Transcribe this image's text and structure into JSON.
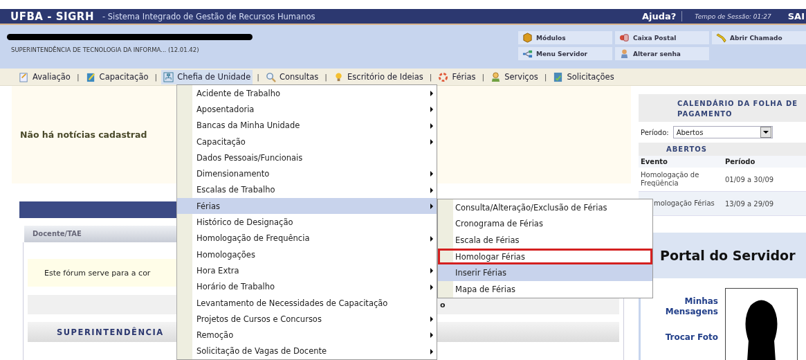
{
  "header": {
    "system": "UFBA - SIGRH",
    "subtitle": "- Sistema Integrado de Gestão de Recursos Humanos",
    "help": "Ajuda?",
    "session": "Tempo de Sessão: 01:27",
    "logout": "SAI"
  },
  "user": {
    "unit": "SUPERINTENDÊNCIA DE TECNOLOGIA DA INFORMA... (12.01.42)"
  },
  "shortcuts": [
    {
      "label": "Módulos",
      "kind": "box"
    },
    {
      "label": "Caixa Postal",
      "kind": "mail"
    },
    {
      "label": "Abrir Chamado",
      "kind": "hand"
    },
    {
      "label": "Menu Servidor",
      "kind": "network"
    },
    {
      "label": "Alterar senha",
      "kind": "user"
    }
  ],
  "menu_bar": {
    "separator": "|",
    "items": [
      {
        "label": "Avaliação",
        "kind": "clipboard",
        "selected": false
      },
      {
        "label": "Capacitação",
        "kind": "pencil",
        "selected": false
      },
      {
        "label": "Chefia de Unidade",
        "kind": "chart",
        "selected": true
      },
      {
        "label": "Consultas",
        "kind": "search",
        "selected": false
      },
      {
        "label": "Escritório de Ideias",
        "kind": "bulb",
        "selected": false
      },
      {
        "label": "Férias",
        "kind": "ring",
        "selected": false
      },
      {
        "label": "Serviços",
        "kind": "person",
        "selected": false
      },
      {
        "label": "Solicitações",
        "kind": "form",
        "selected": false
      }
    ]
  },
  "dropdown": [
    {
      "label": "Acidente de Trabalho",
      "submenu": true,
      "selected": false
    },
    {
      "label": "Aposentadoria",
      "submenu": true,
      "selected": false
    },
    {
      "label": "Bancas da Minha Unidade",
      "submenu": true,
      "selected": false
    },
    {
      "label": "Capacitação",
      "submenu": true,
      "selected": false
    },
    {
      "label": "Dados Pessoais/Funcionais",
      "submenu": false,
      "selected": false
    },
    {
      "label": "Dimensionamento",
      "submenu": true,
      "selected": false
    },
    {
      "label": "Escalas de Trabalho",
      "submenu": true,
      "selected": false
    },
    {
      "label": "Férias",
      "submenu": true,
      "selected": true
    },
    {
      "label": "Histórico de Designação",
      "submenu": false,
      "selected": false
    },
    {
      "label": "Homologação de Frequência",
      "submenu": true,
      "selected": false
    },
    {
      "label": "Homologações",
      "submenu": false,
      "selected": false
    },
    {
      "label": "Hora Extra",
      "submenu": true,
      "selected": false
    },
    {
      "label": "Horário de Trabalho",
      "submenu": true,
      "selected": false
    },
    {
      "label": "Levantamento de Necessidades de Capacitação",
      "submenu": false,
      "selected": false
    },
    {
      "label": "Projetos de Cursos e Concursos",
      "submenu": true,
      "selected": false
    },
    {
      "label": "Remoção",
      "submenu": true,
      "selected": false
    },
    {
      "label": "Solicitação de Vagas de Docente",
      "submenu": true,
      "selected": false
    }
  ],
  "submenu": [
    {
      "label": "Consulta/Alteração/Exclusão de Férias",
      "selected": false,
      "outlined": false
    },
    {
      "label": "Cronograma de Férias",
      "selected": false,
      "outlined": false
    },
    {
      "label": "Escala de Férias",
      "selected": false,
      "outlined": false
    },
    {
      "label": "Homologar Férias",
      "selected": false,
      "outlined": true
    },
    {
      "label": "Inserir Férias",
      "selected": true,
      "outlined": false
    },
    {
      "label": "Mapa de Férias",
      "selected": false,
      "outlined": false
    }
  ],
  "news": "Não há notícias cadastrad",
  "panel": {
    "tab": "Docente/TAE",
    "forum": "Este fórum serve para a cor",
    "fragment": "o",
    "section": "SUPERINTENDÊNCIA"
  },
  "calendar": {
    "title": "CALENDÁRIO DA FOLHA DE PAGAMENTO",
    "period_label": "Período:",
    "period_value": "Abertos",
    "open_title": "ABERTOS",
    "columns": [
      "Evento",
      "Período"
    ],
    "rows": [
      [
        "Homologação de Freqüência",
        "01/09 a 30/09"
      ],
      [
        "mologação Férias",
        "13/09 a 29/09"
      ]
    ]
  },
  "portal": {
    "title": "Portal do Servidor",
    "links": [
      "Minhas Mensagens",
      "Trocar Foto"
    ]
  }
}
